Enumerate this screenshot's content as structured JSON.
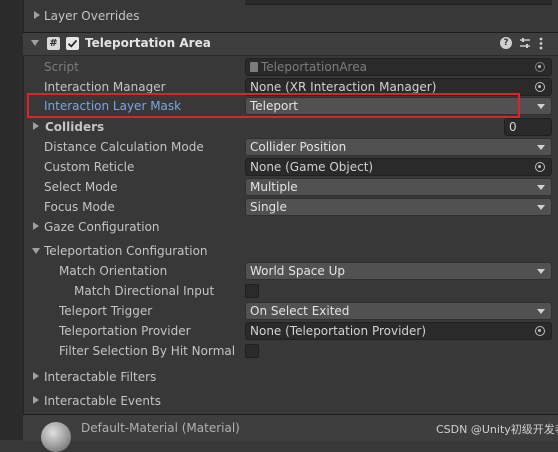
{
  "top_section": {
    "label": "Layer Overrides"
  },
  "component": {
    "title": "Teleportation Area",
    "enabled": true,
    "icons": [
      "help-icon",
      "preset-icon",
      "context-menu-icon"
    ]
  },
  "fields": {
    "script": {
      "label": "Script",
      "value": "TeleportationArea"
    },
    "interaction_manager": {
      "label": "Interaction Manager",
      "value": "None (XR Interaction Manager)"
    },
    "interaction_layer_mask": {
      "label": "Interaction Layer Mask",
      "value": "Teleport"
    },
    "colliders": {
      "label": "Colliders",
      "count": "0"
    },
    "distance_calculation_mode": {
      "label": "Distance Calculation Mode",
      "value": "Collider Position"
    },
    "custom_reticle": {
      "label": "Custom Reticle",
      "value": "None (Game Object)"
    },
    "select_mode": {
      "label": "Select Mode",
      "value": "Multiple"
    },
    "focus_mode": {
      "label": "Focus Mode",
      "value": "Single"
    }
  },
  "gaze_configuration": {
    "label": "Gaze Configuration"
  },
  "teleportation_configuration": {
    "label": "Teleportation Configuration",
    "match_orientation": {
      "label": "Match Orientation",
      "value": "World Space Up"
    },
    "match_directional_input": {
      "label": "Match Directional Input",
      "checked": false
    },
    "teleport_trigger": {
      "label": "Teleport Trigger",
      "value": "On Select Exited"
    },
    "teleportation_provider": {
      "label": "Teleportation Provider",
      "value": "None (Teleportation Provider)"
    },
    "filter_selection_by_hit_normal": {
      "label": "Filter Selection By Hit Normal",
      "checked": false
    }
  },
  "interactable_filters": {
    "label": "Interactable Filters"
  },
  "interactable_events": {
    "label": "Interactable Events"
  },
  "material": {
    "label": "Default-Material (Material)"
  },
  "watermark": "CSDN @Unity初级开发者",
  "colors": {
    "highlight_box": "#e0202a",
    "accent_label": "#7aa6dc",
    "background": "#383838"
  }
}
